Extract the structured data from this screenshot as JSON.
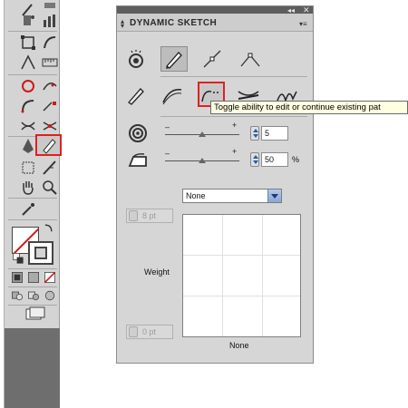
{
  "panel": {
    "title": "DYNAMIC SKETCH",
    "collapse_glyph": "◂◂",
    "close_glyph": "✕",
    "menu_glyph": "▾≡",
    "row1": [
      {
        "name": "auto-draw-icon",
        "active": false
      },
      {
        "name": "sketch-pen-icon",
        "active": false
      },
      {
        "name": "straight-line-icon",
        "active": false
      },
      {
        "name": "angle-line-icon",
        "active": false
      }
    ],
    "row2": [
      {
        "name": "freehand-pen-icon",
        "active": false
      },
      {
        "name": "smooth-stroke-icon",
        "active": false
      },
      {
        "name": "edit-existing-path-icon",
        "active": true
      },
      {
        "name": "merge-paths-icon",
        "active": false
      },
      {
        "name": "scribble-paths-icon",
        "active": false
      }
    ],
    "smoothness": {
      "value": "5",
      "minus": "–",
      "plus": "+",
      "level": 0.5
    },
    "fidelity": {
      "value": "50",
      "unit": "%",
      "minus": "–",
      "plus": "+",
      "level": 0.5
    },
    "profile_select": {
      "selected": "None"
    },
    "weight_top": "8 pt",
    "weight_bottom": "0 pt",
    "weight_label": "Weight",
    "profile_preview_label": "None"
  },
  "tooltip": {
    "text": "Toggle ability to edit or continue existing pat"
  },
  "accent": {
    "highlight": "#e02020",
    "spinner_blue": "#1f5ea8",
    "panel_bg": "#d6d6d6"
  }
}
